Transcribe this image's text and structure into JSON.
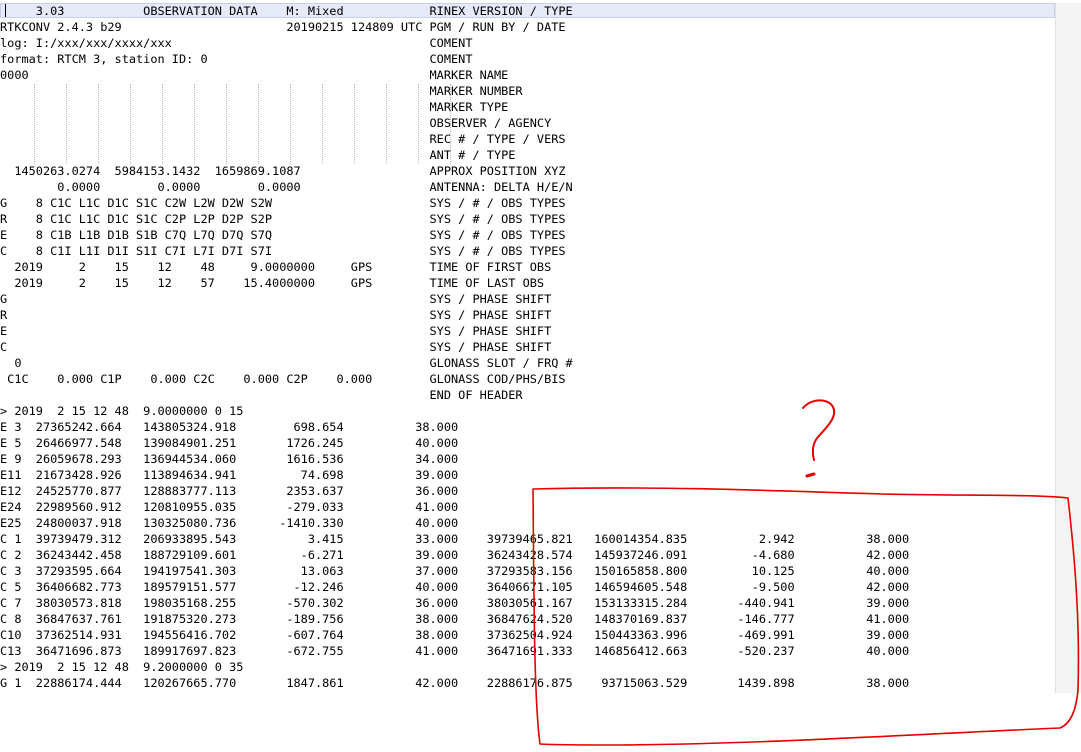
{
  "lines": [
    "     3.03           OBSERVATION DATA    M: Mixed            RINEX VERSION / TYPE",
    "RTKCONV 2.4.3 b29                       20190215 124809 UTC PGM / RUN BY / DATE",
    "log: I:/xxx/xxx/xxxx/xxx                                    COMENT",
    "format: RTCM 3, station ID: 0                               COMENT",
    "0000                                                        MARKER NAME",
    "                                                            MARKER NUMBER",
    "                                                            MARKER TYPE",
    "                                                            OBSERVER / AGENCY",
    "                                                            REC # / TYPE / VERS",
    "                                                            ANT # / TYPE",
    "  1450263.0274  5984153.1432  1659869.1087                  APPROX POSITION XYZ",
    "        0.0000        0.0000        0.0000                  ANTENNA: DELTA H/E/N",
    "G    8 C1C L1C D1C S1C C2W L2W D2W S2W                      SYS / # / OBS TYPES",
    "R    8 C1C L1C D1C S1C C2P L2P D2P S2P                      SYS / # / OBS TYPES",
    "E    8 C1B L1B D1B S1B C7Q L7Q D7Q S7Q                      SYS / # / OBS TYPES",
    "C    8 C1I L1I D1I S1I C7I L7I D7I S7I                      SYS / # / OBS TYPES",
    "  2019     2    15    12    48     9.0000000     GPS        TIME OF FIRST OBS",
    "  2019     2    15    12    57    15.4000000     GPS        TIME OF LAST OBS",
    "G                                                           SYS / PHASE SHIFT",
    "R                                                           SYS / PHASE SHIFT",
    "E                                                           SYS / PHASE SHIFT",
    "C                                                           SYS / PHASE SHIFT",
    "  0                                                         GLONASS SLOT / FRQ #",
    " C1C    0.000 C1P    0.000 C2C    0.000 C2P    0.000        GLONASS COD/PHS/BIS",
    "                                                            END OF HEADER",
    "> 2019  2 15 12 48  9.0000000 0 15",
    "E 3  27365242.664   143805324.918        698.654          38.000",
    "E 5  26466977.548   139084901.251       1726.245          40.000",
    "E 9  26059678.293   136944534.060       1616.536          34.000",
    "E11  21673428.926   113894634.941         74.698          39.000",
    "E12  24525770.877   128883777.113       2353.637          36.000",
    "E24  22989560.912   120810955.035       -279.033          41.000",
    "E25  24800037.918   130325080.736      -1410.330          40.000",
    "C 1  39739479.312   206933895.543          3.415          33.000    39739465.821   160014354.835          2.942          38.000",
    "C 2  36243442.458   188729109.601         -6.271          39.000    36243428.574   145937246.091         -4.680          42.000",
    "C 3  37293595.664   194197541.303         13.063          37.000    37293583.156   150165858.800         10.125          40.000",
    "C 5  36406682.773   189579151.577        -12.246          40.000    36406671.105   146594605.548         -9.500          42.000",
    "C 7  38030573.818   198035168.255       -570.302          36.000    38030561.167   153133315.284       -440.941          39.000",
    "C 8  36847637.761   191875320.273       -189.756          38.000    36847624.520   148370169.837       -146.777          41.000",
    "C10  37362514.931   194556416.702       -607.764          38.000    37362504.924   150443363.996       -469.991          39.000",
    "C13  36471696.873   189917697.823       -672.755          41.000    36471691.333   146856412.663       -520.237          40.000",
    "> 2019  2 15 12 48  9.2000000 0 35",
    "G 1  22886174.444   120267665.770       1847.861          42.000    22886176.875    93715063.529       1439.898          38.000"
  ],
  "annotation": {
    "stroke_color": "#e60000",
    "shape": "rounded-box-with-question-mark",
    "question_mark": "?"
  },
  "colors": {
    "current_line": "#e6eaf8",
    "text": "#000000",
    "background": "#ffffff"
  }
}
